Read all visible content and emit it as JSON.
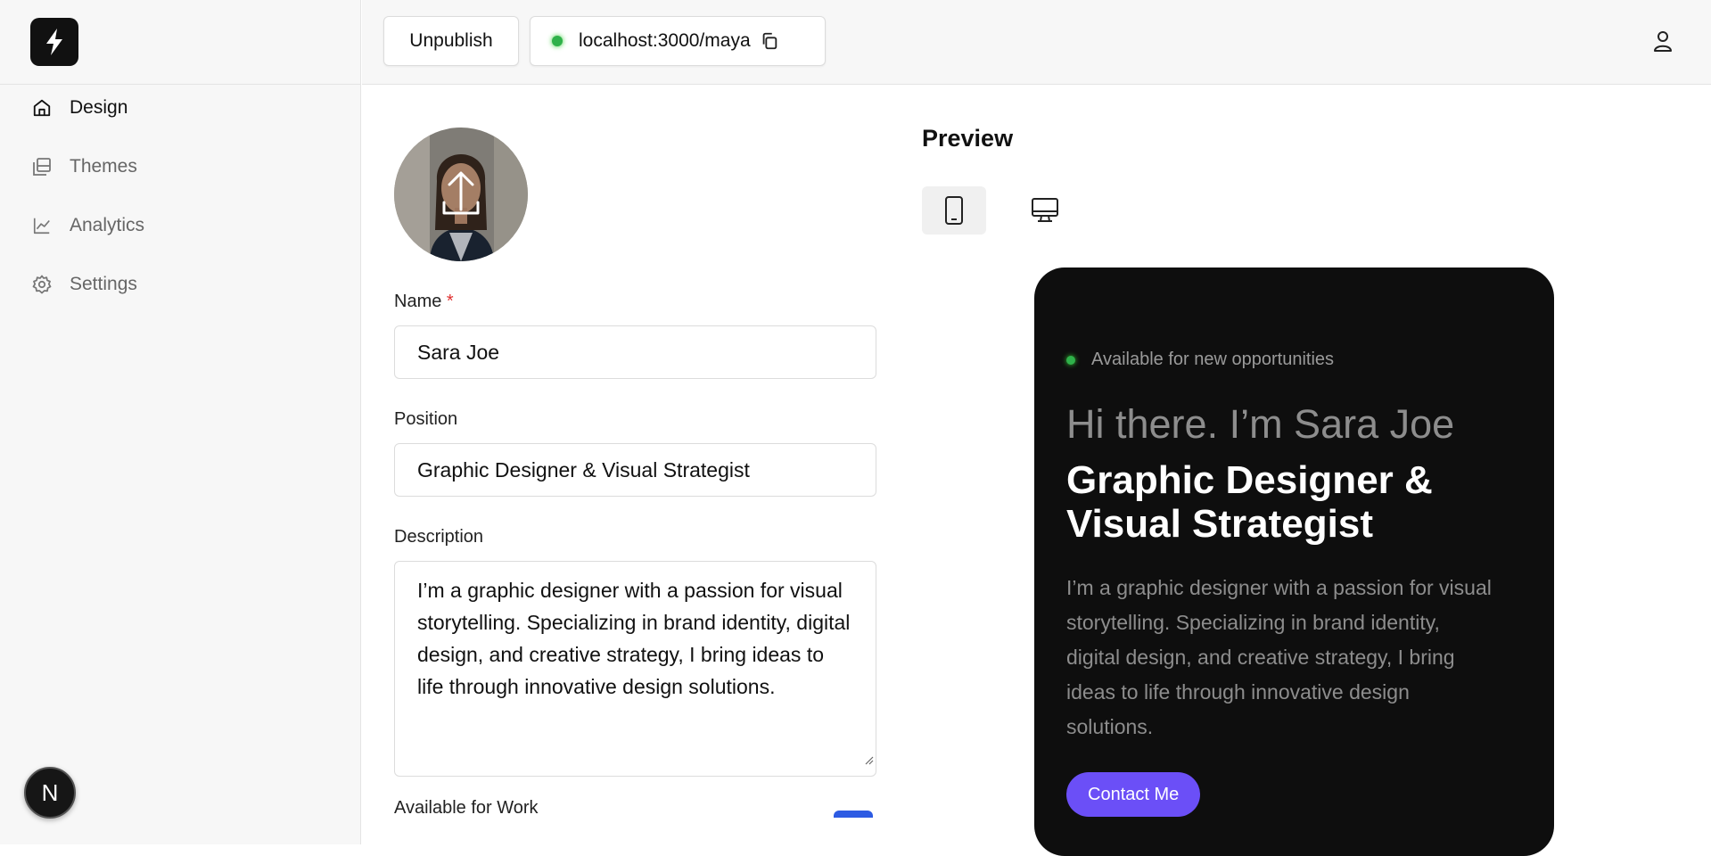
{
  "app": {
    "accent": "#6b4ff7",
    "status_green": "#2fb14a"
  },
  "sidebar": {
    "items": [
      {
        "label": "Design",
        "icon": "home-icon",
        "active": true
      },
      {
        "label": "Themes",
        "icon": "layers-icon",
        "active": false
      },
      {
        "label": "Analytics",
        "icon": "chart-line-icon",
        "active": false
      },
      {
        "label": "Settings",
        "icon": "gear-icon",
        "active": false
      }
    ],
    "badge": "N"
  },
  "topbar": {
    "unpublish_label": "Unpublish",
    "url": "localhost:3000/maya"
  },
  "form": {
    "name_label": "Name",
    "required_mark": "*",
    "name_value": "Sara Joe",
    "position_label": "Position",
    "position_value": "Graphic Designer & Visual Strategist",
    "description_label": "Description",
    "description_value": "I’m a graphic designer with a passion for visual storytelling. Specializing in brand identity, digital design, and creative strategy, I bring ideas to life through innovative design solutions.",
    "available_label": "Available for Work"
  },
  "preview": {
    "title": "Preview",
    "availability": "Available for new opportunities",
    "greeting": "Hi there. I’m Sara Joe",
    "role": "Graphic Designer & Visual Strategist",
    "description": "I’m a graphic designer with a passion for visual storytelling. Specializing in brand identity, digital design, and creative strategy, I bring ideas to life through innovative design solutions.",
    "cta": "Contact Me"
  }
}
